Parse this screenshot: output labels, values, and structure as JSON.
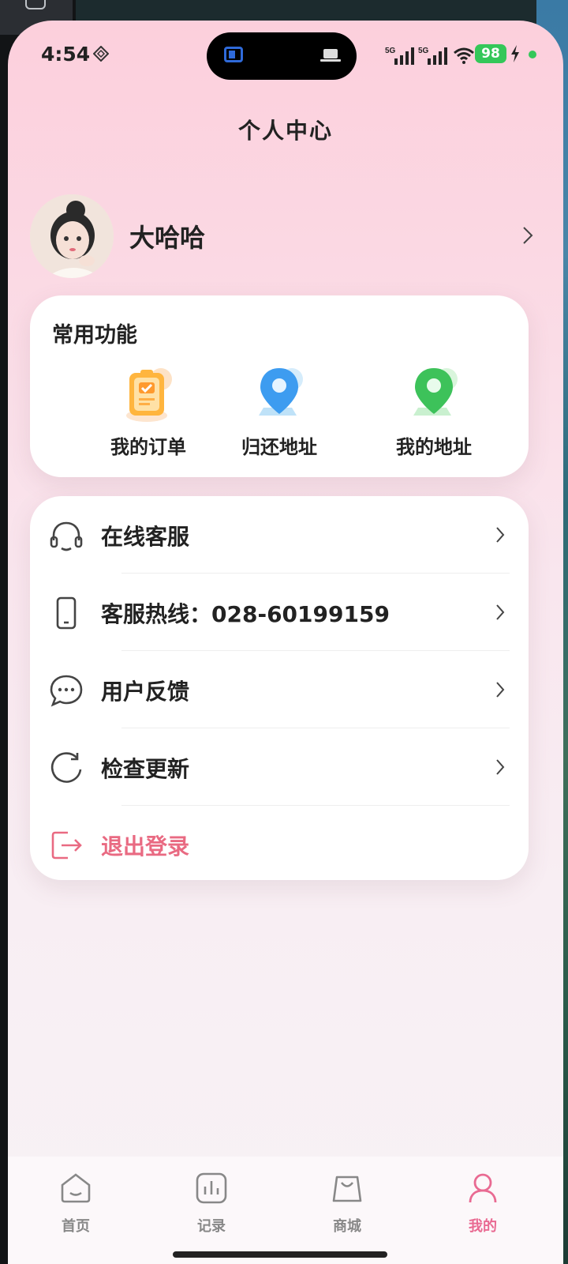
{
  "status_bar": {
    "time": "4:54",
    "network_1": "5G",
    "network_2": "5G",
    "battery": "98"
  },
  "header": {
    "title": "个人中心"
  },
  "profile": {
    "name": "大哈哈"
  },
  "common_functions": {
    "title": "常用功能",
    "items": [
      {
        "label": "我的订单",
        "icon": "clipboard-order-icon"
      },
      {
        "label": "归还地址",
        "icon": "blue-location-pin-icon"
      },
      {
        "label": "我的地址",
        "icon": "green-location-pin-icon"
      }
    ]
  },
  "menu": {
    "items": [
      {
        "label": "在线客服",
        "icon": "headset-icon"
      },
      {
        "label": "客服热线：028-60199159",
        "icon": "phone-icon"
      },
      {
        "label": "用户反馈",
        "icon": "chat-bubble-icon"
      },
      {
        "label": "检查更新",
        "icon": "refresh-icon"
      },
      {
        "label": "退出登录",
        "icon": "logout-icon"
      }
    ]
  },
  "tabbar": {
    "items": [
      {
        "label": "首页",
        "icon": "home-icon"
      },
      {
        "label": "记录",
        "icon": "chart-icon"
      },
      {
        "label": "商城",
        "icon": "shopping-bag-icon"
      },
      {
        "label": "我的",
        "icon": "person-icon",
        "active": true
      }
    ]
  },
  "colors": {
    "accent": "#e96a92",
    "logout": "#e96a82",
    "battery": "#34c759"
  }
}
